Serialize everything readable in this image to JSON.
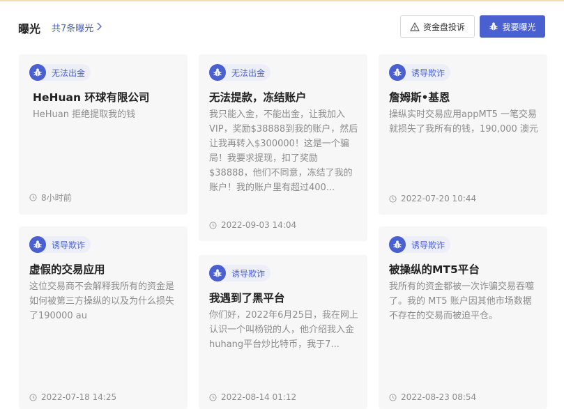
{
  "header": {
    "title": "曝光",
    "count_link": "共7条曝光",
    "complaint_button": "资金盘投诉",
    "expose_button": "我要曝光"
  },
  "cards": [
    {
      "tag": "无法出金",
      "title": "HeHuan 环球有限公司",
      "desc": "HeHuan 拒绝提取我的钱",
      "time": "8小时前"
    },
    {
      "tag": "无法出金",
      "title": "无法提款，冻结账户",
      "desc": "我只能入金，不能出金，让我加入VIP，奖励$38888到我的账户，然后让我再转入$300000！这是一个骗局！我要求提现，扣了奖励$38888，他们不同意，冻结了我的账户！我的账户里有超过400...",
      "time": "2022-09-03 14:04"
    },
    {
      "tag": "诱导欺诈",
      "title": "詹姆斯•基恩",
      "desc": "操纵实时交易应用appMT5 一笔交易就损失了我所有的钱，190,000 澳元",
      "time": "2022-07-20 10:44"
    },
    {
      "tag": "诱导欺诈",
      "title": "虚假的交易应用",
      "desc": "这位交易商不会解释我所有的资金是如何被第三方操纵的以及为什么损失了190000 au",
      "time": "2022-07-18 14:25"
    },
    {
      "tag": "诱导欺诈",
      "title": "我遇到了黑平台",
      "desc": "你们好，2022年6月25日，我在网上认识一个叫杨锐的人，他介绍我入金huhang平台炒比特币，我于7...",
      "time": "2022-08-14 01:12"
    },
    {
      "tag": "诱导欺诈",
      "title": "被操纵的MT5平台",
      "desc": "我所有的资金都被一次诈骗交易吞噬了。我的 MT5 账户因其他市场数据不存在的交易而被迫平仓。",
      "time": "2022-08-23 08:54"
    }
  ]
}
